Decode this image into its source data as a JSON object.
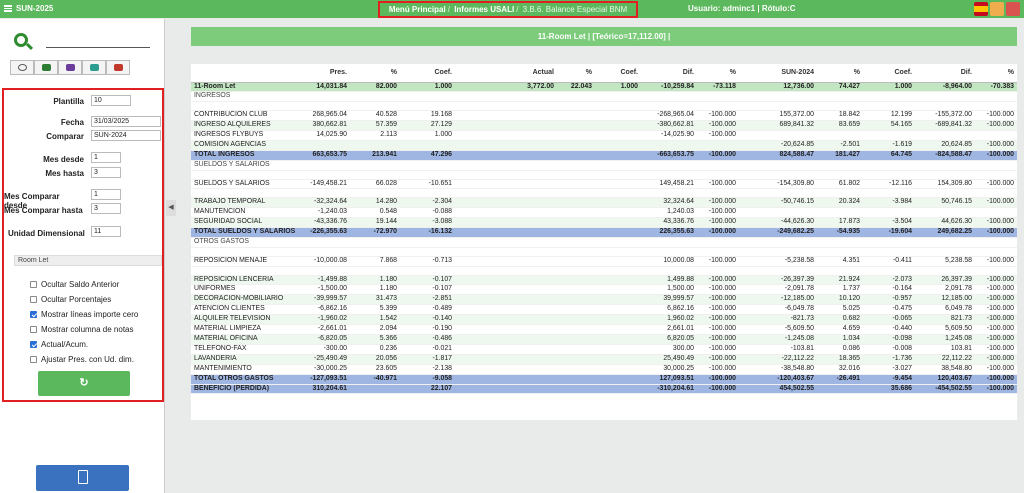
{
  "topbar": {
    "app": "SUN-2025",
    "bc1": "Menú Principal",
    "bc2": "Informes USALI",
    "bc3": "3.B.6. Balance Especial BNM",
    "sep": "/",
    "user": "Usuario: adminc1 | Rótulo:C"
  },
  "filters": {
    "plantilla_label": "Plantilla",
    "plantilla": "10",
    "fecha_label": "Fecha",
    "fecha": "31/03/2025",
    "comparar_label": "Comparar",
    "comparar": "SUN-2024",
    "mes_desde_label": "Mes desde",
    "mes_desde": "1",
    "mes_hasta_label": "Mes hasta",
    "mes_hasta": "3",
    "mcd_label": "Mes Comparar desde",
    "mcd": "1",
    "mch_label": "Mes Comparar hasta",
    "mch": "3",
    "ud_label": "Unidad Dimensional",
    "ud": "11",
    "ud_text": "Room Let",
    "checks": [
      {
        "label": "Ocultar Saldo Anterior",
        "on": false
      },
      {
        "label": "Ocultar Porcentajes",
        "on": false
      },
      {
        "label": "Mostrar líneas importe cero",
        "on": true
      },
      {
        "label": "Mostrar columna de notas",
        "on": false
      },
      {
        "label": "Actual/Acum.",
        "on": true
      },
      {
        "label": "Ajustar Pres. con Ud. dim.",
        "on": false
      }
    ]
  },
  "banner": "11-Room Let | [Teórico=17,112.00] |",
  "columns": [
    "",
    "Pres.",
    "%",
    "Coef.",
    "",
    "Actual",
    "%",
    "Coef.",
    "Dif.",
    "%",
    "SUN-2024",
    "%",
    "Coef.",
    "Dif.",
    "%"
  ],
  "rows": [
    {
      "t": "hdr",
      "c": [
        "11-Room Let",
        "14,031.84",
        "82.000",
        "1.000",
        "",
        "3,772.00",
        "22.043",
        "1.000",
        "-10,259.84",
        "-73.118",
        "12,736.00",
        "74.427",
        "1.000",
        "-8,964.00",
        "-70.383"
      ]
    },
    {
      "t": "sec",
      "c": [
        "INGRESOS",
        "",
        "",
        "",
        "",
        "",
        "",
        "",
        "",
        "",
        "",
        "",
        "",
        "",
        ""
      ]
    },
    {
      "t": "",
      "c": [
        "",
        "",
        "",
        "",
        "",
        "",
        "",
        "",
        "",
        "",
        "",
        "",
        "",
        "",
        ""
      ]
    },
    {
      "t": "",
      "c": [
        "CONTRIBUCION CLUB",
        "268,965.04",
        "40.528",
        "19.168",
        "",
        "",
        "",
        "",
        "-268,965.04",
        "-100.000",
        "155,372.00",
        "18.842",
        "12.199",
        "-155,372.00",
        "-100.000"
      ]
    },
    {
      "t": "alt",
      "c": [
        "INGRESO ALQUILERES",
        "380,662.81",
        "57.359",
        "27.129",
        "",
        "",
        "",
        "",
        "-380,662.81",
        "-100.000",
        "689,841.32",
        "83.659",
        "54.165",
        "-689,841.32",
        "-100.000"
      ]
    },
    {
      "t": "",
      "c": [
        "INGRESOS FLYBUYS",
        "14,025.90",
        "2.113",
        "1.000",
        "",
        "",
        "",
        "",
        "-14,025.90",
        "-100.000",
        "",
        "",
        "",
        "",
        ""
      ]
    },
    {
      "t": "alt",
      "c": [
        "COMISION AGENCIAS",
        "",
        "",
        "",
        "",
        "",
        "",
        "",
        "",
        "",
        "-20,624.85",
        "-2.501",
        "-1.619",
        "20,624.85",
        "-100.000"
      ]
    },
    {
      "t": "tot",
      "c": [
        "TOTAL INGRESOS",
        "663,653.75",
        "213.941",
        "47.296",
        "",
        "",
        "",
        "",
        "-663,653.75",
        "-100.000",
        "824,588.47",
        "181.427",
        "64.745",
        "-824,588.47",
        "-100.000"
      ]
    },
    {
      "t": "sec",
      "c": [
        "SUELDOS Y SALARIOS",
        "",
        "",
        "",
        "",
        "",
        "",
        "",
        "",
        "",
        "",
        "",
        "",
        "",
        ""
      ]
    },
    {
      "t": "",
      "c": [
        "",
        "",
        "",
        "",
        "",
        "",
        "",
        "",
        "",
        "",
        "",
        "",
        "",
        "",
        ""
      ]
    },
    {
      "t": "",
      "c": [
        "SUELDOS Y SALARIOS",
        "-149,458.21",
        "66.028",
        "-10.651",
        "",
        "",
        "",
        "",
        "149,458.21",
        "-100.000",
        "-154,309.80",
        "61.802",
        "-12.116",
        "154,309.80",
        "-100.000"
      ]
    },
    {
      "t": "",
      "c": [
        "",
        "",
        "",
        "",
        "",
        "",
        "",
        "",
        "",
        "",
        "",
        "",
        "",
        "",
        ""
      ]
    },
    {
      "t": "alt",
      "c": [
        "TRABAJO TEMPORAL",
        "-32,324.64",
        "14.280",
        "-2.304",
        "",
        "",
        "",
        "",
        "32,324.64",
        "-100.000",
        "-50,746.15",
        "20.324",
        "-3.984",
        "50,746.15",
        "-100.000"
      ]
    },
    {
      "t": "",
      "c": [
        "MANUTENCION",
        "-1,240.03",
        "0.548",
        "-0.088",
        "",
        "",
        "",
        "",
        "1,240.03",
        "-100.000",
        "",
        "",
        "",
        "",
        ""
      ]
    },
    {
      "t": "alt",
      "c": [
        "SEGURIDAD SOCIAL",
        "-43,336.76",
        "19.144",
        "-3.088",
        "",
        "",
        "",
        "",
        "43,336.76",
        "-100.000",
        "-44,626.30",
        "17.873",
        "-3.504",
        "44,626.30",
        "-100.000"
      ]
    },
    {
      "t": "tot",
      "c": [
        "TOTAL SUELDOS Y SALARIOS",
        "-226,355.63",
        "-72.970",
        "-16.132",
        "",
        "",
        "",
        "",
        "226,355.63",
        "-100.000",
        "-249,682.25",
        "-54.935",
        "-19.604",
        "249,682.25",
        "-100.000"
      ]
    },
    {
      "t": "sec",
      "c": [
        "OTROS GASTOS",
        "",
        "",
        "",
        "",
        "",
        "",
        "",
        "",
        "",
        "",
        "",
        "",
        "",
        ""
      ]
    },
    {
      "t": "",
      "c": [
        "",
        "",
        "",
        "",
        "",
        "",
        "",
        "",
        "",
        "",
        "",
        "",
        "",
        "",
        ""
      ]
    },
    {
      "t": "",
      "c": [
        "REPOSICION MENAJE",
        "-10,000.08",
        "7.868",
        "-0.713",
        "",
        "",
        "",
        "",
        "10,000.08",
        "-100.000",
        "-5,238.58",
        "4.351",
        "-0.411",
        "5,238.58",
        "-100.000"
      ]
    },
    {
      "t": "",
      "c": [
        "",
        "",
        "",
        "",
        "",
        "",
        "",
        "",
        "",
        "",
        "",
        "",
        "",
        "",
        ""
      ]
    },
    {
      "t": "alt",
      "c": [
        "REPOSICION LENCERIA",
        "-1,499.88",
        "1.180",
        "-0.107",
        "",
        "",
        "",
        "",
        "1,499.88",
        "-100.000",
        "-26,397.39",
        "21.924",
        "-2.073",
        "26,397.39",
        "-100.000"
      ]
    },
    {
      "t": "",
      "c": [
        "UNIFORMES",
        "-1,500.00",
        "1.180",
        "-0.107",
        "",
        "",
        "",
        "",
        "1,500.00",
        "-100.000",
        "-2,091.78",
        "1.737",
        "-0.164",
        "2,091.78",
        "-100.000"
      ]
    },
    {
      "t": "alt",
      "c": [
        "DECORACION-MOBILIARIO",
        "-39,999.57",
        "31.473",
        "-2.851",
        "",
        "",
        "",
        "",
        "39,999.57",
        "-100.000",
        "-12,185.00",
        "10.120",
        "-0.957",
        "12,185.00",
        "-100.000"
      ]
    },
    {
      "t": "",
      "c": [
        "ATENCION CLIENTES",
        "-6,862.16",
        "5.399",
        "-0.489",
        "",
        "",
        "",
        "",
        "6,862.16",
        "-100.000",
        "-6,049.78",
        "5.025",
        "-0.475",
        "6,049.78",
        "-100.000"
      ]
    },
    {
      "t": "alt",
      "c": [
        "ALQUILER TELEVISION",
        "-1,960.02",
        "1.542",
        "-0.140",
        "",
        "",
        "",
        "",
        "1,960.02",
        "-100.000",
        "-821.73",
        "0.682",
        "-0.065",
        "821.73",
        "-100.000"
      ]
    },
    {
      "t": "",
      "c": [
        "MATERIAL LIMPIEZA",
        "-2,661.01",
        "2.094",
        "-0.190",
        "",
        "",
        "",
        "",
        "2,661.01",
        "-100.000",
        "-5,609.50",
        "4.659",
        "-0.440",
        "5,609.50",
        "-100.000"
      ]
    },
    {
      "t": "alt",
      "c": [
        "MATERIAL OFICINA",
        "-6,820.05",
        "5.366",
        "-0.486",
        "",
        "",
        "",
        "",
        "6,820.05",
        "-100.000",
        "-1,245.08",
        "1.034",
        "-0.098",
        "1,245.08",
        "-100.000"
      ]
    },
    {
      "t": "",
      "c": [
        "TELEFONO-FAX",
        "-300.00",
        "0.236",
        "-0.021",
        "",
        "",
        "",
        "",
        "300.00",
        "-100.000",
        "-103.81",
        "0.086",
        "-0.008",
        "103.81",
        "-100.000"
      ]
    },
    {
      "t": "alt",
      "c": [
        "LAVANDERIA",
        "-25,490.49",
        "20.056",
        "-1.817",
        "",
        "",
        "",
        "",
        "25,490.49",
        "-100.000",
        "-22,112.22",
        "18.365",
        "-1.736",
        "22,112.22",
        "-100.000"
      ]
    },
    {
      "t": "",
      "c": [
        "MANTENIMIENTO",
        "-30,000.25",
        "23.605",
        "-2.138",
        "",
        "",
        "",
        "",
        "30,000.25",
        "-100.000",
        "-38,548.80",
        "32.016",
        "-3.027",
        "38,548.80",
        "-100.000"
      ]
    },
    {
      "t": "tot",
      "c": [
        "TOTAL OTROS GASTOS",
        "-127,093.51",
        "-40.971",
        "-9.058",
        "",
        "",
        "",
        "",
        "127,093.51",
        "-100.000",
        "-120,403.67",
        "-26.491",
        "-9.454",
        "120,403.67",
        "-100.000"
      ]
    },
    {
      "t": "ben",
      "c": [
        "BENEFICIO (PERDIDA)",
        "310,204.61",
        "",
        "22.107",
        "",
        "",
        "",
        "",
        "-310,204.61",
        "-100.000",
        "454,502.55",
        "",
        "35.686",
        "-454,502.55",
        "-100.000"
      ]
    }
  ]
}
